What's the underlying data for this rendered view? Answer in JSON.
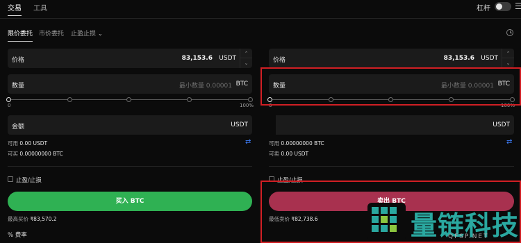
{
  "top_tabs": [
    {
      "label": "交易",
      "active": true
    },
    {
      "label": "工具",
      "active": false
    }
  ],
  "leverage": {
    "label": "杠杆",
    "enabled": false
  },
  "order_types": [
    {
      "label": "限价委托",
      "active": true
    },
    {
      "label": "市价委托",
      "active": false
    },
    {
      "label": "止盈止损",
      "active": false
    }
  ],
  "buy": {
    "price": {
      "label": "价格",
      "value": "83,153.6",
      "unit": "USDT"
    },
    "amount": {
      "label": "数量",
      "placeholder": "最小数量 0.00001",
      "unit": "BTC"
    },
    "slider": {
      "min_label": "0",
      "max_label": "100%",
      "level_percent": 0
    },
    "total": {
      "label": "金额",
      "unit": "USDT"
    },
    "available_label": "可用",
    "available_value": "0.00 USDT",
    "buyable_label": "可买",
    "buyable_value": "0.00000000 BTC",
    "tpsl_label": "止盈/止损",
    "button_label": "买入 BTC",
    "best_price_label": "最高买价",
    "best_price_value": "₹83,570.2"
  },
  "sell": {
    "price": {
      "label": "价格",
      "value": "83,153.6",
      "unit": "USDT"
    },
    "amount": {
      "label": "数量",
      "placeholder": "最小数量 0.00001",
      "unit": "BTC"
    },
    "slider": {
      "min_label": "0",
      "max_label": "100%",
      "level_percent": 0
    },
    "total": {
      "unit": "USDT"
    },
    "available_label": "可用",
    "available_value": "0.00000000 BTC",
    "sellable_label": "可卖",
    "sellable_value": "0.00 USDT",
    "tpsl_label": "止盈/止损",
    "button_label": "卖出 BTC",
    "best_price_label": "最低卖价",
    "best_price_value": "₹82,738.6"
  },
  "fee_label": "费率",
  "watermark": {
    "text": "量链科技",
    "sub": "QFSP.NET"
  },
  "colors": {
    "buy": "#2fb153",
    "sell": "#a8314f",
    "highlight": "#d11f24",
    "swap_icon": "#3d7cf5",
    "watermark": "#2aa8a0"
  },
  "icons": [
    "chevron-down-icon",
    "clock-icon",
    "menu-icon",
    "swap-icon",
    "percent-icon",
    "stepper-up-icon",
    "stepper-down-icon"
  ]
}
